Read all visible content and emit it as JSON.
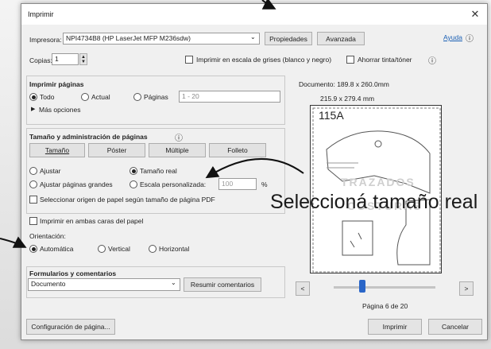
{
  "dialog": {
    "title": "Imprimir",
    "close_glyph": "✕",
    "help_link": "Ayuda",
    "help_icon": "ⓘ"
  },
  "printer": {
    "label": "Impresora:",
    "value": "NPI4734B8 (HP LaserJet MFP M236sdw)",
    "properties_button": "Propiedades",
    "advanced_button": "Avanzada"
  },
  "copies": {
    "label": "Copias:",
    "value": "1",
    "grayscale_label": "Imprimir en escala de grises (blanco y negro)",
    "save_ink_label": "Ahorrar tinta/tóner",
    "info_icon": "ⓘ"
  },
  "pages": {
    "section_title": "Imprimir páginas",
    "options": [
      "Todo",
      "Actual",
      "Páginas"
    ],
    "selected": "Todo",
    "range_placeholder": "1 - 20",
    "more_options": "Más opciones"
  },
  "sizing": {
    "section_title": "Tamaño y administración de páginas",
    "tabs": [
      "Tamaño",
      "Póster",
      "Múltiple",
      "Folleto"
    ],
    "fit": "Ajustar",
    "actual_size": "Tamaño real",
    "shrink": "Ajustar páginas grandes",
    "custom_scale": "Escala personalizada:",
    "scale_value": "100",
    "percent": "%",
    "choose_source": "Seleccionar origen de papel según tamaño de página PDF"
  },
  "duplex": {
    "label": "Imprimir en ambas caras del papel"
  },
  "orientation": {
    "label": "Orientación:",
    "options": [
      "Automática",
      "Vertical",
      "Horizontal"
    ],
    "selected": "Automática"
  },
  "comments": {
    "section_title": "Formularios y comentarios",
    "value": "Documento",
    "summarize_button": "Resumir comentarios"
  },
  "preview": {
    "document_size": "Documento: 189.8 x 260.0mm",
    "paper_size": "215.9 x 279.4 mm",
    "page_label": "115A",
    "watermark_line1": "TRAZADOS",
    "watermark_line2": "COSTURAS",
    "prev_button": "<",
    "next_button": ">",
    "page_indicator": "Página 6 de 20"
  },
  "footer": {
    "page_setup_button": "Configuración de página...",
    "print_button": "Imprimir",
    "cancel_button": "Cancelar"
  },
  "annotation": {
    "text": "Seleccioná tamaño real"
  }
}
